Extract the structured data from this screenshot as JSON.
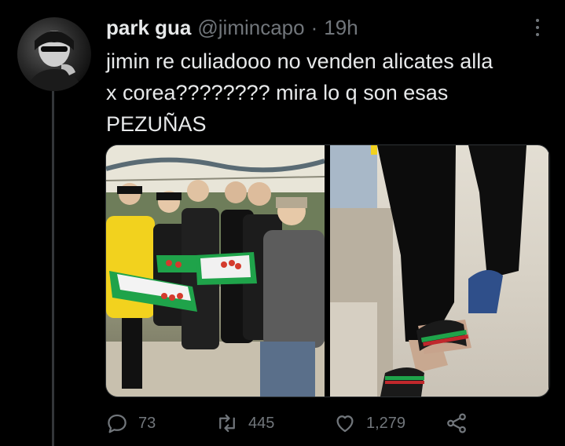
{
  "tweet": {
    "display_name": "park gua",
    "handle": "@jimincapo",
    "separator": "·",
    "time": "19h",
    "text_lines": [
      "jimin re culiadooo no venden alicates alla",
      "x corea???????? mira lo q son esas",
      "PEZUÑAS"
    ]
  },
  "actions": {
    "reply_count": "73",
    "retweet_count": "445",
    "like_count": "1,279"
  },
  "icons": {
    "reply": "reply-icon",
    "retweet": "retweet-icon",
    "like": "heart-icon",
    "share": "share-icon",
    "more": "more-icon"
  },
  "colors": {
    "background": "#000000",
    "text": "#e7e9ea",
    "secondary": "#71767b",
    "tray": "#1fa34a"
  }
}
